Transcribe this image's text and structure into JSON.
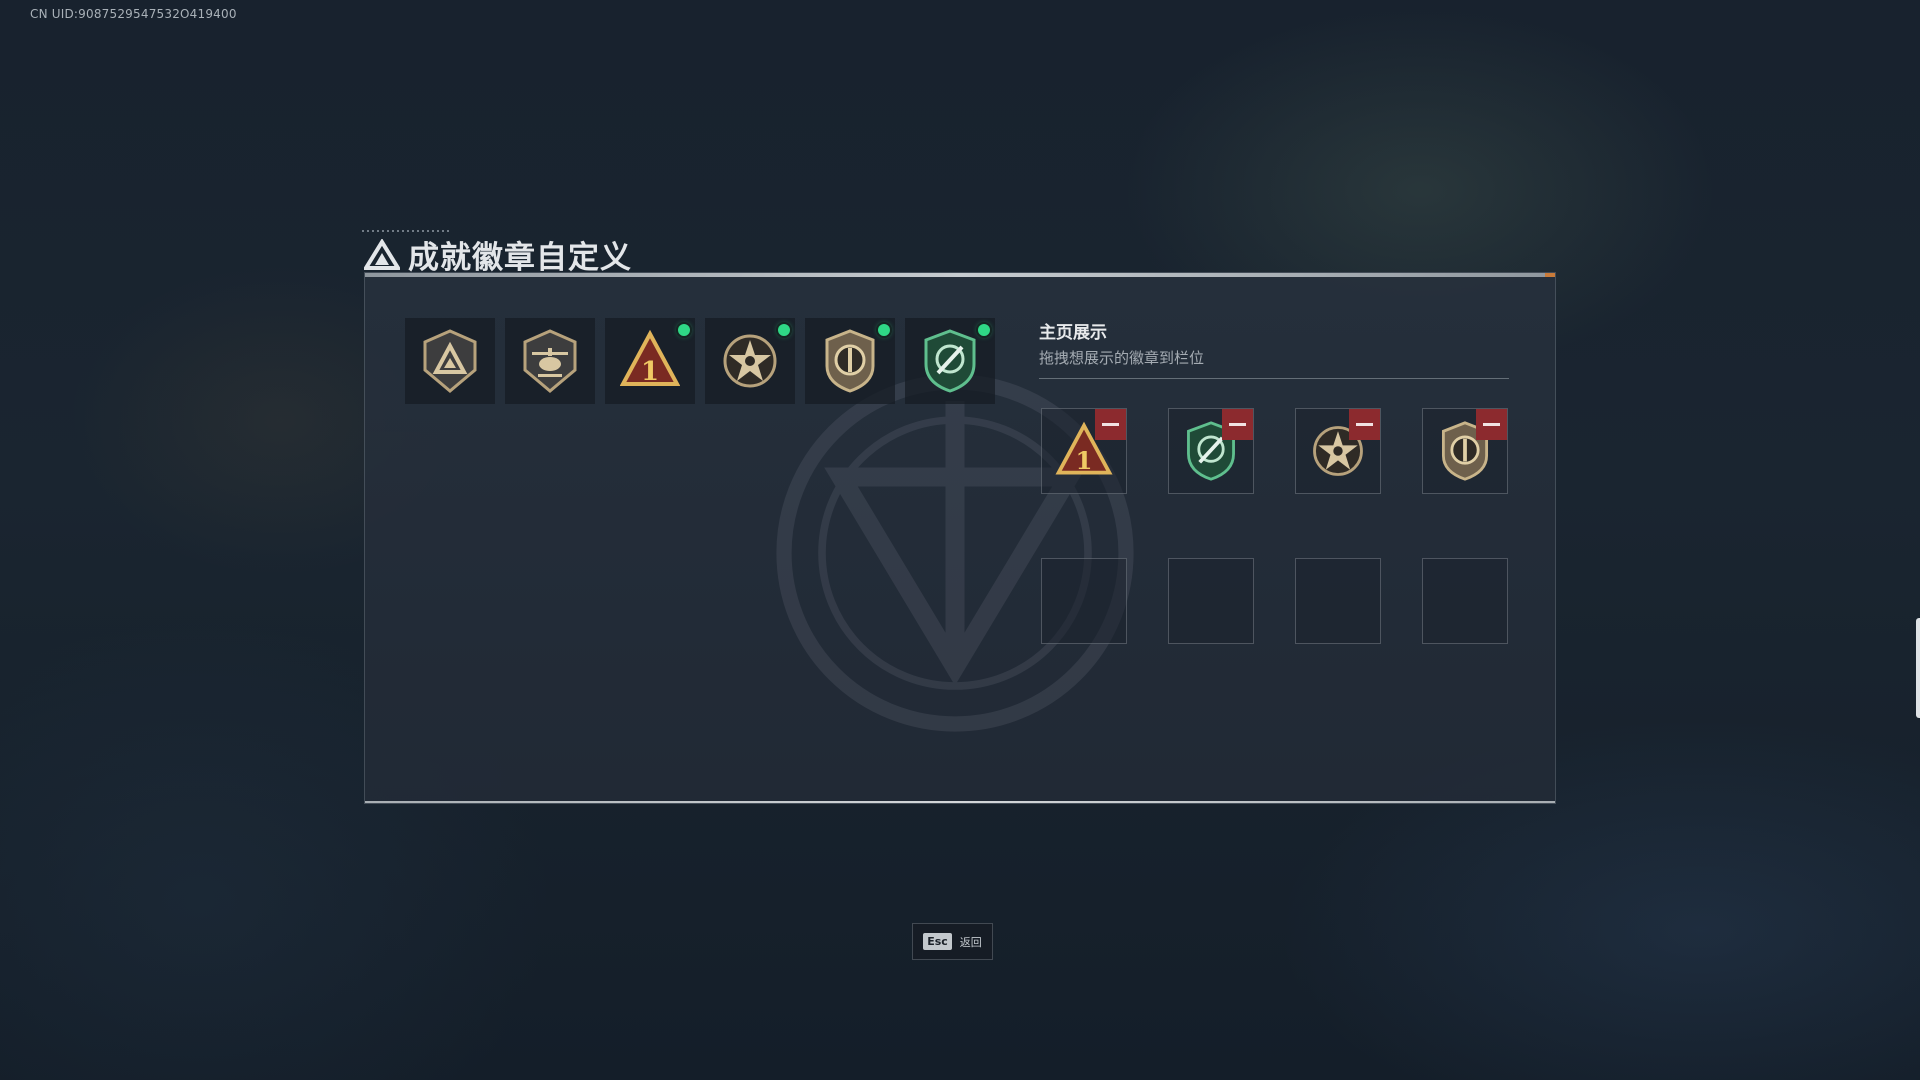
{
  "uid_text": "CN UID:9087529547532O419400",
  "title": "成就徽章自定义",
  "showcase": {
    "title": "主页展示",
    "subtitle": "拖拽想展示的徽章到栏位"
  },
  "esc": {
    "key": "Esc",
    "label": "返回"
  },
  "colors": {
    "new_dot": "#2fd886",
    "remove": "#8c2a2e",
    "accent": "#c97b3a"
  },
  "owned_badges": [
    {
      "icon": "triangle-shield-badge-icon",
      "new": false
    },
    {
      "icon": "helicopter-badge-icon",
      "new": false
    },
    {
      "icon": "number-one-triangle-badge-icon",
      "new": true
    },
    {
      "icon": "star-badge-icon",
      "new": true
    },
    {
      "icon": "round-emblem-badge-icon",
      "new": true
    },
    {
      "icon": "green-shield-badge-icon",
      "new": true
    }
  ],
  "showcase_slots": [
    {
      "icon": "number-one-triangle-badge-icon",
      "filled": true
    },
    {
      "icon": "green-shield-badge-icon",
      "filled": true
    },
    {
      "icon": "star-badge-icon",
      "filled": true
    },
    {
      "icon": "round-emblem-badge-icon",
      "filled": true
    },
    {
      "filled": false
    },
    {
      "filled": false
    },
    {
      "filled": false
    },
    {
      "filled": false
    }
  ]
}
